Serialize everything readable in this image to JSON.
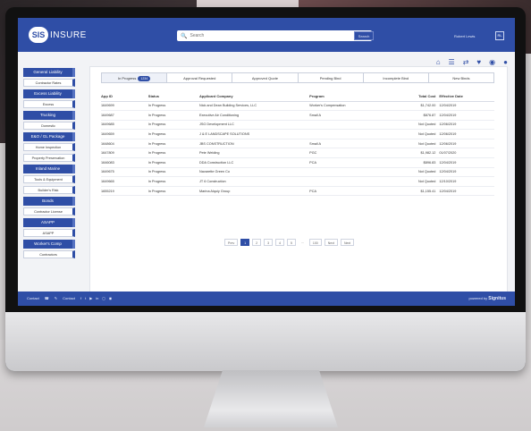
{
  "app": {
    "logo_badge": "SIS",
    "logo_text": "INSURE",
    "search_placeholder": "Search",
    "search_button": "Search",
    "user_name": "Robert Lewis",
    "user_initials": "RL"
  },
  "icons": [
    "home-icon",
    "list-icon",
    "transfer-icon",
    "heart-icon",
    "help-icon",
    "chat-icon"
  ],
  "sidebar": [
    {
      "head": "General Liability",
      "items": [
        "Contractor Rates"
      ]
    },
    {
      "head": "Excess Liability",
      "items": [
        "Excess"
      ]
    },
    {
      "head": "Trucking",
      "items": [
        "Domestic"
      ]
    },
    {
      "head": "E&O / GL Package",
      "items": [
        "Home Inspection",
        "Property Preservation"
      ]
    },
    {
      "head": "Inland Marine",
      "items": [
        "Tools & Equipment",
        "Builder's Risk"
      ]
    },
    {
      "head": "Bonds",
      "items": [
        "Contractor License"
      ]
    },
    {
      "head": "ASAPP",
      "items": [
        "ASAPP"
      ]
    },
    {
      "head": "Worker's Comp",
      "items": [
        "Contractors"
      ]
    }
  ],
  "tabs": [
    {
      "label": "In Progress",
      "count": "1234"
    },
    {
      "label": "Approval Requested",
      "count": ""
    },
    {
      "label": "Approved Quote",
      "count": ""
    },
    {
      "label": "Pending Bind",
      "count": ""
    },
    {
      "label": "Incomplete Bind",
      "count": ""
    },
    {
      "label": "New Binds",
      "count": ""
    }
  ],
  "table": {
    "headers": [
      "App ID",
      "Status",
      "Applicant Company",
      "Program",
      "Total Cost",
      "Effective Date"
    ],
    "rows": [
      [
        "1649699",
        "In Progress",
        "Nick and Dean Building Services, LLC",
        "Worker's Compensation",
        "$1,742.00",
        "12/04/2019"
      ],
      [
        "1649687",
        "In Progress",
        "Executive Air Conditioning",
        "Small A",
        "$876.87",
        "12/04/2019"
      ],
      [
        "1649685",
        "In Progress",
        "JSG Development LLC",
        "",
        "Not Quoted",
        "12/06/2019"
      ],
      [
        "1649659",
        "In Progress",
        "J & E LANDSCAPE SOLUTIONS",
        "",
        "Not Quoted",
        "12/06/2019"
      ],
      [
        "1648604",
        "In Progress",
        "JBS CONSTRUCTION",
        "Small A",
        "Not Quoted",
        "12/06/2019"
      ],
      [
        "1647809",
        "In Progress",
        "Pete Welding",
        "PGC",
        "$1,982.12",
        "01/07/2020"
      ],
      [
        "1646083",
        "In Progress",
        "DDA Construction LLC",
        "PCA",
        "$896.83",
        "12/04/2019"
      ],
      [
        "1649675",
        "In Progress",
        "Navarette Green Co",
        "",
        "Not Quoted",
        "12/04/2019"
      ],
      [
        "1649665",
        "In Progress",
        "JT 6 Construction",
        "",
        "Not Quoted",
        "12/10/2019"
      ],
      [
        "1655219",
        "In Progress",
        "Marina Alquiy Group",
        "PCA",
        "$1,155.41",
        "12/04/2019"
      ]
    ]
  },
  "pager": [
    "Prev",
    "1",
    "2",
    "3",
    "4",
    "5",
    "...",
    "100",
    "Next",
    "Next"
  ],
  "footer": {
    "contact": "Contact",
    "links": "Contact",
    "brand_prefix": "powered by",
    "brand": "Signitus"
  }
}
